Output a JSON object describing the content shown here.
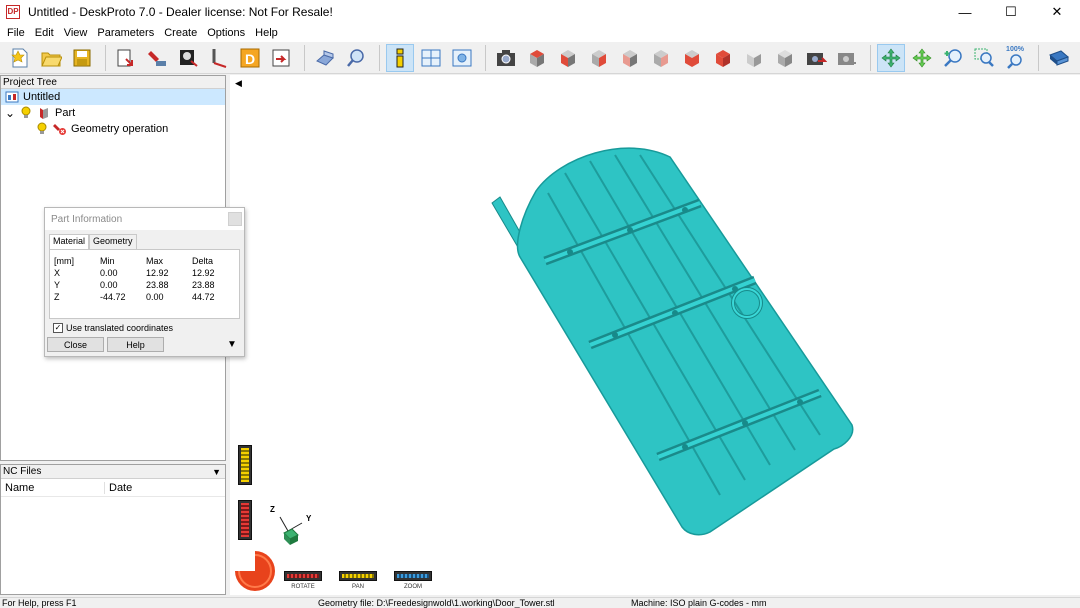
{
  "window": {
    "title": "Untitled - DeskProto 7.0 - Dealer license: Not For Resale!",
    "app_icon_text": "DP",
    "minimize": "—",
    "maximize": "☐",
    "close": "✕"
  },
  "menu": [
    "File",
    "Edit",
    "View",
    "Parameters",
    "Create",
    "Options",
    "Help"
  ],
  "toolbar": {
    "buttons": [
      "new-project-icon",
      "open-project-icon",
      "save-project-icon",
      "import-geometry-icon",
      "geometry-operation-icon",
      "bitmap-operation-icon",
      "vector-operation-icon",
      "drawing-operation-icon",
      "export-icon",
      "edit-part-icon",
      "zoom-part-icon",
      "part-information-icon",
      "layout-window-icon",
      "view-window-icon",
      "screenshot-icon",
      "view-top-icon",
      "view-bottom-icon",
      "view-left-icon",
      "view-right-icon",
      "view-front-icon",
      "view-back-icon",
      "view-iso-icon",
      "view-iso2-icon",
      "render-icon",
      "render2-icon",
      "rotate-tool-icon",
      "pan-tool-icon",
      "zoom-in-tool-icon",
      "zoom-window-icon",
      "zoom-100-icon",
      "help-book-icon"
    ],
    "zoom_100_label": "100%"
  },
  "project_tree": {
    "header": "Project Tree",
    "items": [
      {
        "label": "Untitled"
      },
      {
        "label": "Part",
        "expander": "⌄"
      },
      {
        "label": "Geometry operation"
      }
    ]
  },
  "nc_files": {
    "header": "NC Files",
    "columns": [
      "Name",
      "Date"
    ]
  },
  "part_info": {
    "title": "Part Information",
    "tabs": [
      "Material",
      "Geometry"
    ],
    "table": {
      "headers": [
        "[mm]",
        "Min",
        "Max",
        "Delta"
      ],
      "rows": [
        [
          "X",
          "0.00",
          "12.92",
          "12.92"
        ],
        [
          "Y",
          "0.00",
          "23.88",
          "23.88"
        ],
        [
          "Z",
          "-44.72",
          "0.00",
          "44.72"
        ]
      ]
    },
    "checkbox_label": "Use translated coordinates",
    "checkbox_checked": "✓",
    "close_label": "Close",
    "help_label": "Help"
  },
  "viewport": {
    "axis_labels": {
      "z": "Z",
      "y": "Y"
    },
    "nav_controls": {
      "rotate": "ROTATE",
      "pan": "PAN",
      "zoom": "ZOOM"
    },
    "model_color": "#2ec4c4"
  },
  "status": {
    "help": "For Help, press F1",
    "geometry_file": "Geometry file: D:\\Freedesignwold\\1.working\\Door_Tower.stl",
    "machine": "Machine: ISO plain G-codes - mm"
  }
}
